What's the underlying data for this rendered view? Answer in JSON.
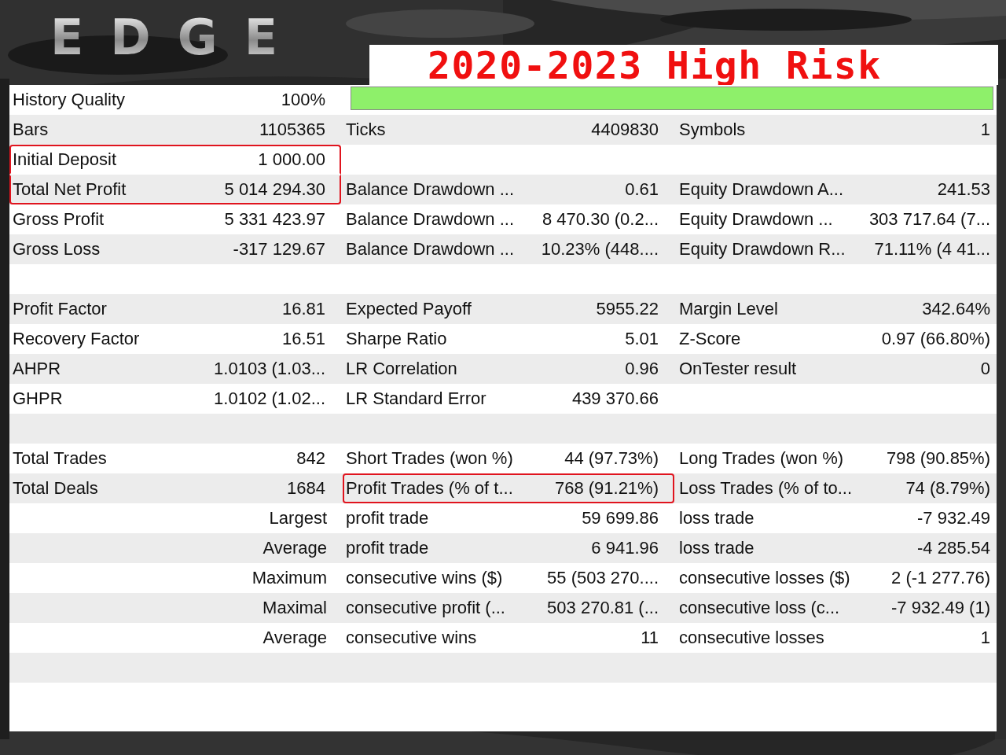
{
  "logo": "EDGE",
  "title": "2020-2023 High Risk",
  "rows": [
    {
      "kind": "quality",
      "label": "History Quality",
      "value": "100%",
      "level": 1
    },
    {
      "kind": "stats",
      "cells": [
        {
          "label": "Bars",
          "value": "1105365",
          "highlighted": false
        },
        {
          "label": "Ticks",
          "value": "4409830",
          "highlighted": false
        },
        {
          "label": "Symbols",
          "value": "1",
          "highlighted": false
        }
      ]
    },
    {
      "kind": "stats",
      "cells": [
        {
          "label": "Initial Deposit",
          "value": "1 000.00",
          "highlighted": true
        },
        null,
        null
      ]
    },
    {
      "kind": "stats",
      "cells": [
        {
          "label": "Total Net Profit",
          "value": "5 014 294.30",
          "highlighted": true
        },
        {
          "label": "Balance Drawdown ...",
          "value": "0.61",
          "highlighted": false
        },
        {
          "label": "Equity Drawdown A...",
          "value": "241.53",
          "highlighted": false
        }
      ]
    },
    {
      "kind": "stats",
      "cells": [
        {
          "label": "Gross Profit",
          "value": "5 331 423.97",
          "highlighted": false
        },
        {
          "label": "Balance Drawdown ...",
          "value": "8 470.30 (0.2...",
          "highlighted": false
        },
        {
          "label": "Equity Drawdown ...",
          "value": "303 717.64 (7...",
          "highlighted": false
        }
      ]
    },
    {
      "kind": "stats",
      "cells": [
        {
          "label": "Gross Loss",
          "value": "-317 129.67",
          "highlighted": false
        },
        {
          "label": "Balance Drawdown ...",
          "value": "10.23% (448....",
          "highlighted": false
        },
        {
          "label": "Equity Drawdown R...",
          "value": "71.11% (4 41...",
          "highlighted": false
        }
      ]
    },
    {
      "kind": "blank"
    },
    {
      "kind": "stats",
      "cells": [
        {
          "label": "Profit Factor",
          "value": "16.81",
          "highlighted": false
        },
        {
          "label": "Expected Payoff",
          "value": "5955.22",
          "highlighted": false
        },
        {
          "label": "Margin Level",
          "value": "342.64%",
          "highlighted": false
        }
      ]
    },
    {
      "kind": "stats",
      "cells": [
        {
          "label": "Recovery Factor",
          "value": "16.51",
          "highlighted": false
        },
        {
          "label": "Sharpe Ratio",
          "value": "5.01",
          "highlighted": false
        },
        {
          "label": "Z-Score",
          "value": "0.97 (66.80%)",
          "highlighted": false
        }
      ]
    },
    {
      "kind": "stats",
      "cells": [
        {
          "label": "AHPR",
          "value": "1.0103 (1.03...",
          "highlighted": false
        },
        {
          "label": "LR Correlation",
          "value": "0.96",
          "highlighted": false
        },
        {
          "label": "OnTester result",
          "value": "0",
          "highlighted": false
        }
      ]
    },
    {
      "kind": "stats",
      "cells": [
        {
          "label": "GHPR",
          "value": "1.0102 (1.02...",
          "highlighted": false
        },
        {
          "label": "LR Standard Error",
          "value": "439 370.66",
          "highlighted": false
        },
        null
      ]
    },
    {
      "kind": "blank"
    },
    {
      "kind": "stats",
      "cells": [
        {
          "label": "Total Trades",
          "value": "842",
          "highlighted": false
        },
        {
          "label": "Short Trades (won %)",
          "value": "44 (97.73%)",
          "highlighted": false
        },
        {
          "label": "Long Trades (won %)",
          "value": "798 (90.85%)",
          "highlighted": false
        }
      ]
    },
    {
      "kind": "stats",
      "cells": [
        {
          "label": "Total Deals",
          "value": "1684",
          "highlighted": false
        },
        {
          "label": "Profit Trades (% of t...",
          "value": "768 (91.21%)",
          "highlighted": true
        },
        {
          "label": "Loss Trades (% of to...",
          "value": "74 (8.79%)",
          "highlighted": false
        }
      ]
    },
    {
      "kind": "detail",
      "heading": "Largest",
      "cells": [
        {
          "label": "profit trade",
          "value": "59 699.86",
          "highlighted": false
        },
        {
          "label": "loss trade",
          "value": "-7 932.49",
          "highlighted": false
        }
      ]
    },
    {
      "kind": "detail",
      "heading": "Average",
      "cells": [
        {
          "label": "profit trade",
          "value": "6 941.96",
          "highlighted": false
        },
        {
          "label": "loss trade",
          "value": "-4 285.54",
          "highlighted": false
        }
      ]
    },
    {
      "kind": "detail",
      "heading": "Maximum",
      "cells": [
        {
          "label": "consecutive wins ($)",
          "value": "55 (503 270....",
          "highlighted": false
        },
        {
          "label": "consecutive losses ($)",
          "value": "2 (-1 277.76)",
          "highlighted": false
        }
      ]
    },
    {
      "kind": "detail",
      "heading": "Maximal",
      "cells": [
        {
          "label": "consecutive profit (...",
          "value": "503 270.81 (...",
          "highlighted": false
        },
        {
          "label": "consecutive loss (c...",
          "value": "-7 932.49 (1)",
          "highlighted": false
        }
      ]
    },
    {
      "kind": "detail",
      "heading": "Average",
      "cells": [
        {
          "label": "consecutive wins",
          "value": "11",
          "highlighted": false
        },
        {
          "label": "consecutive losses",
          "value": "1",
          "highlighted": false
        }
      ]
    },
    {
      "kind": "blank"
    }
  ]
}
